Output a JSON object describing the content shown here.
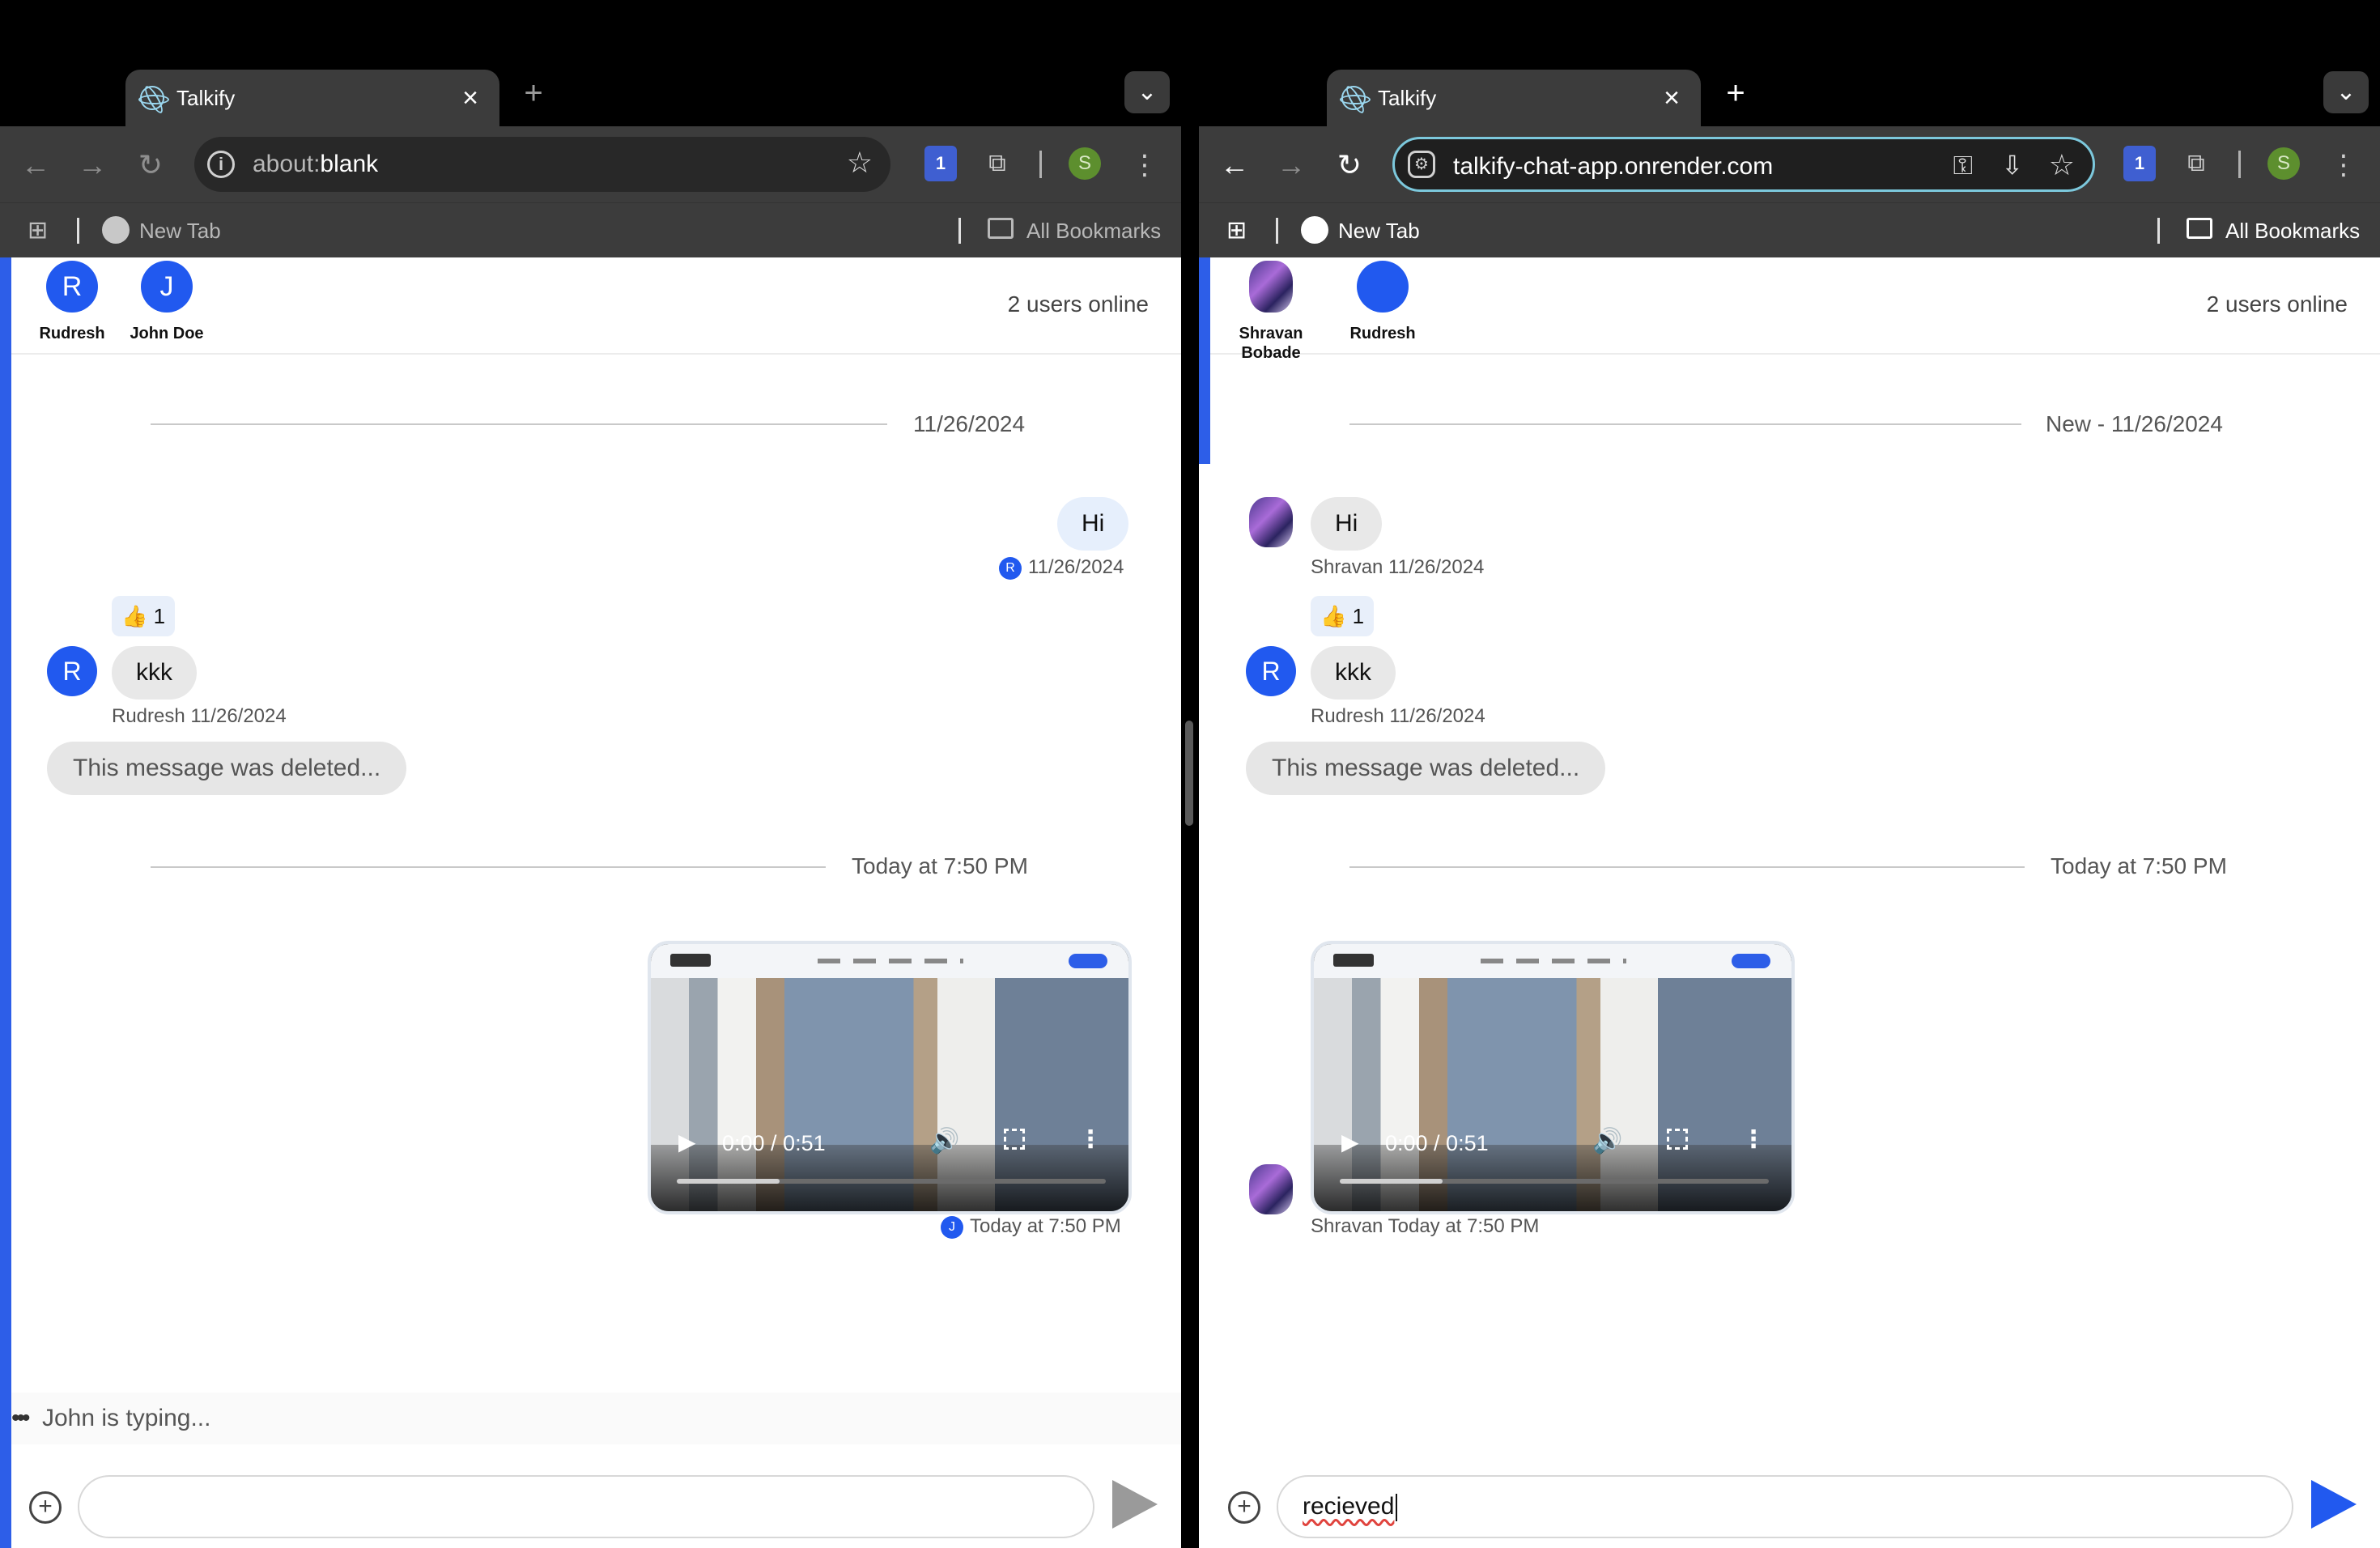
{
  "left": {
    "tab": {
      "title": "Talkify",
      "close": "×"
    },
    "new_tab": "+",
    "tab_search": "⌄",
    "nav": {
      "back": "←",
      "forward": "→",
      "reload": "↻"
    },
    "omnibox": {
      "info": "i",
      "prefix": "about:",
      "suffix": "blank",
      "star": "☆"
    },
    "ext": {
      "shield_badge": "1",
      "puzzle": "⧉"
    },
    "profile": "S",
    "menu": "⋮",
    "bookmarks": {
      "apps": "⊞",
      "new_tab": "New Tab",
      "all": "All Bookmarks"
    },
    "online_users": [
      {
        "initial": "R",
        "name": "Rudresh"
      },
      {
        "initial": "J",
        "name": "John Doe"
      }
    ],
    "online_count": "2 users online",
    "date_sep_1": "11/26/2024",
    "msg_hi": {
      "text": "Hi",
      "avatar": "R",
      "time": "11/26/2024"
    },
    "reaction": {
      "emoji": "👍",
      "count": "1"
    },
    "msg_kkk": {
      "avatar": "R",
      "text": "kkk",
      "meta": "Rudresh 11/26/2024"
    },
    "deleted": "This message was deleted...",
    "date_sep_2": "Today at 7:50 PM",
    "video": {
      "play": "▶",
      "time": "0:00 / 0:51",
      "volume": "🔊",
      "more": "⋮",
      "progress": 0.0,
      "buffered": 0.24
    },
    "video_meta": {
      "avatar": "J",
      "time": "Today at 7:50 PM"
    },
    "typing": {
      "dots": "•••",
      "text": "John is typing..."
    },
    "composer": {
      "add": "+",
      "value": ""
    }
  },
  "right": {
    "tab": {
      "title": "Talkify",
      "close": "×"
    },
    "new_tab": "+",
    "tab_search": "⌄",
    "nav": {
      "back": "←",
      "forward": "→",
      "reload": "↻"
    },
    "omnibox": {
      "info": "⚙",
      "url": "talkify-chat-app.onrender.com",
      "key": "⚿",
      "install": "⇩",
      "star": "☆"
    },
    "ext": {
      "shield_badge": "1",
      "puzzle": "⧉"
    },
    "profile": "S",
    "menu": "⋮",
    "bookmarks": {
      "apps": "⊞",
      "new_tab": "New Tab",
      "all": "All Bookmarks"
    },
    "online_users": [
      {
        "initial": "",
        "name": "Shravan Bobade"
      },
      {
        "initial": "",
        "name": "Rudresh"
      }
    ],
    "online_count": "2 users online",
    "date_sep_1": "New - 11/26/2024",
    "msg_hi": {
      "text": "Hi",
      "meta": "Shravan 11/26/2024"
    },
    "reaction": {
      "emoji": "👍",
      "count": "1"
    },
    "msg_kkk": {
      "avatar": "R",
      "text": "kkk",
      "meta": "Rudresh 11/26/2024"
    },
    "deleted": "This message was deleted...",
    "date_sep_2": "Today at 7:50 PM",
    "video": {
      "play": "▶",
      "time": "0:00 / 0:51",
      "volume": "🔊",
      "more": "⋮",
      "progress": 0.0,
      "buffered": 0.24
    },
    "video_meta": "Shravan Today at 7:50 PM",
    "composer": {
      "add": "+",
      "value": "recieved"
    }
  },
  "colors": {
    "accent": "#2159ef",
    "accent_bar": "#2d5ee8",
    "focus_ring": "#7cc8dc",
    "profile": "#5d8f2e"
  }
}
